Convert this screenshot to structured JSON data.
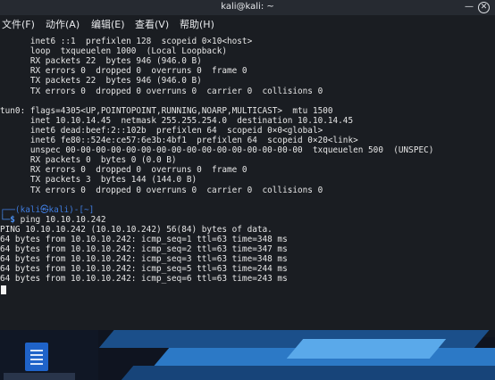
{
  "window": {
    "title": "kali@kali: ~",
    "minimize_glyph": "—",
    "close_glyph": "✕"
  },
  "menu": [
    "文件(F)",
    "动作(A)",
    "编辑(E)",
    "查看(V)",
    "帮助(H)"
  ],
  "terminal": {
    "lines": [
      "      inet6 ::1  prefixlen 128  scopeid 0×10<host>",
      "      loop  txqueuelen 1000  (Local Loopback)",
      "      RX packets 22  bytes 946 (946.0 B)",
      "      RX errors 0  dropped 0  overruns 0  frame 0",
      "      TX packets 22  bytes 946 (946.0 B)",
      "      TX errors 0  dropped 0 overruns 0  carrier 0  collisions 0",
      "",
      "tun0: flags=4305<UP,POINTOPOINT,RUNNING,NOARP,MULTICAST>  mtu 1500",
      "      inet 10.10.14.45  netmask 255.255.254.0  destination 10.10.14.45",
      "      inet6 dead:beef:2::102b  prefixlen 64  scopeid 0×0<global>",
      "      inet6 fe80::524e:ce57:6e3b:4bf1  prefixlen 64  scopeid 0×20<link>",
      "      unspec 00-00-00-00-00-00-00-00-00-00-00-00-00-00-00-00  txqueuelen 500  (UNSPEC)",
      "      RX packets 0  bytes 0 (0.0 B)",
      "      RX errors 0  dropped 0  overruns 0  frame 0",
      "      TX packets 3  bytes 144 (144.0 B)",
      "      TX errors 0  dropped 0 overruns 0  carrier 0  collisions 0",
      ""
    ],
    "prompt": {
      "top": "┌──(kali㉿kali)-[~]",
      "bottom_prefix": "└─$ ",
      "command": "ping 10.10.10.242"
    },
    "output": [
      "PING 10.10.10.242 (10.10.10.242) 56(84) bytes of data.",
      "64 bytes from 10.10.10.242: icmp_seq=1 ttl=63 time=348 ms",
      "64 bytes from 10.10.10.242: icmp_seq=2 ttl=63 time=347 ms",
      "64 bytes from 10.10.10.242: icmp_seq=3 ttl=63 time=348 ms",
      "64 bytes from 10.10.10.242: icmp_seq=5 ttl=63 time=244 ms",
      "64 bytes from 10.10.10.242: icmp_seq=6 ttl=63 time=243 ms"
    ]
  },
  "colors": {
    "terminal_bg": "#1a1d22",
    "titlebar_bg": "#262a31",
    "prompt_blue": "#4a8ff0",
    "text": "#e6e6e6"
  },
  "desktop": {
    "file_icon": "document-icon"
  }
}
